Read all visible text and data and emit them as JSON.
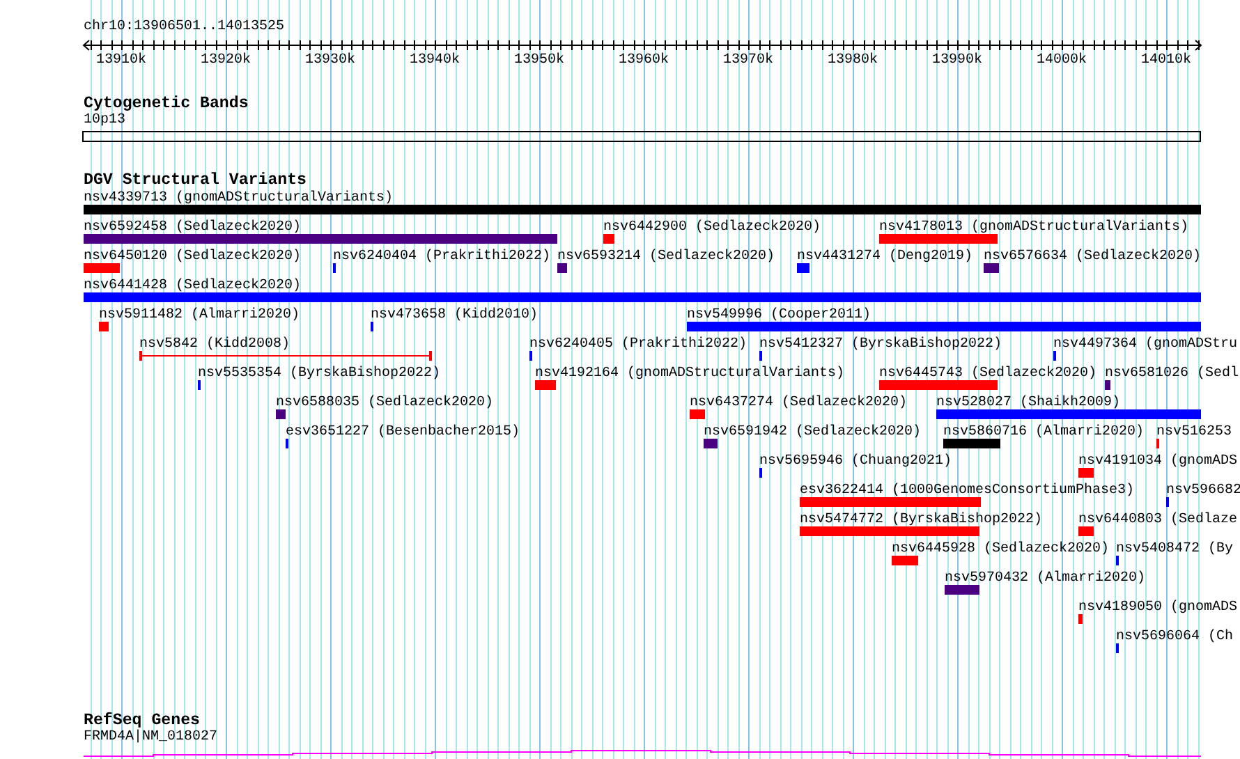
{
  "ruler": {
    "region": "chr10:13906501..14013525",
    "ticks": [
      "13910k",
      "13920k",
      "13930k",
      "13940k",
      "13950k",
      "13960k",
      "13970k",
      "13980k",
      "13990k",
      "14000k",
      "14010k"
    ]
  },
  "tracks": [
    {
      "kind": "bands",
      "title": "Cytogenetic Bands",
      "features": [
        {
          "label": "10p13"
        }
      ]
    },
    {
      "kind": "variants",
      "title": "DGV Structural Variants",
      "features": [
        {
          "label": "nsv4339713 (gnomADStructuralVariants)",
          "color": "#000000",
          "kind": "bar"
        },
        {
          "label": "nsv6592458 (Sedlazeck2020)",
          "color": "#4b0082",
          "kind": "bar"
        },
        {
          "label": "nsv6442900 (Sedlazeck2020)",
          "color": "#ff0000",
          "kind": "bar"
        },
        {
          "label": "nsv4178013 (gnomADStructuralVariants)",
          "color": "#ff0000",
          "kind": "bar"
        },
        {
          "label": "nsv6450120 (Sedlazeck2020)",
          "color": "#ff0000",
          "kind": "bar"
        },
        {
          "label": "nsv6240404 (Prakrithi2022)",
          "color": "#0000ff",
          "kind": "bar"
        },
        {
          "label": "nsv6593214 (Sedlazeck2020)",
          "color": "#4b0082",
          "kind": "bar"
        },
        {
          "label": "nsv4431274 (Deng2019)",
          "color": "#0000ff",
          "kind": "bar"
        },
        {
          "label": "nsv6576634 (Sedlazeck2020)",
          "color": "#4b0082",
          "kind": "bar"
        },
        {
          "label": "nsv6441428 (Sedlazeck2020)",
          "color": "#0000ff",
          "kind": "bar"
        },
        {
          "label": "nsv5911482 (Almarri2020)",
          "color": "#ff0000",
          "kind": "bar"
        },
        {
          "label": "nsv473658 (Kidd2010)",
          "color": "#0000ff",
          "kind": "bar"
        },
        {
          "label": "nsv549996 (Cooper2011)",
          "color": "#0000ff",
          "kind": "bar"
        },
        {
          "label": "nsv5842 (Kidd2008)",
          "color": "#ff0000",
          "kind": "span"
        },
        {
          "label": "nsv6240405 (Prakrithi2022)",
          "color": "#0000ff",
          "kind": "bar"
        },
        {
          "label": "nsv5412327 (ByrskaBishop2022)",
          "color": "#0000ff",
          "kind": "bar"
        },
        {
          "label": "nsv4497364 (gnomADStru",
          "color": "#0000ff",
          "kind": "bar"
        },
        {
          "label": "nsv5535354 (ByrskaBishop2022)",
          "color": "#0000ff",
          "kind": "bar"
        },
        {
          "label": "nsv4192164 (gnomADStructuralVariants)",
          "color": "#ff0000",
          "kind": "bar"
        },
        {
          "label": "nsv6445743 (Sedlazeck2020)",
          "color": "#ff0000",
          "kind": "bar"
        },
        {
          "label": "nsv6581026 (Sedl",
          "color": "#4b0082",
          "kind": "bar"
        },
        {
          "label": "nsv6588035 (Sedlazeck2020)",
          "color": "#4b0082",
          "kind": "bar"
        },
        {
          "label": "nsv6437274 (Sedlazeck2020)",
          "color": "#ff0000",
          "kind": "bar"
        },
        {
          "label": "nsv528027 (Shaikh2009)",
          "color": "#0000ff",
          "kind": "bar"
        },
        {
          "label": "esv3651227 (Besenbacher2015)",
          "color": "#0000ff",
          "kind": "bar"
        },
        {
          "label": "nsv6591942 (Sedlazeck2020)",
          "color": "#4b0082",
          "kind": "bar"
        },
        {
          "label": "nsv5860716 (Almarri2020)",
          "color": "#000000",
          "kind": "bar"
        },
        {
          "label": "nsv516253",
          "color": "#ff0000",
          "kind": "bar"
        },
        {
          "label": "nsv5695946 (Chuang2021)",
          "color": "#0000ff",
          "kind": "bar"
        },
        {
          "label": "nsv4191034 (gnomADS",
          "color": "#ff0000",
          "kind": "bar"
        },
        {
          "label": "esv3622414 (1000GenomesConsortiumPhase3)",
          "color": "#ff0000",
          "kind": "bar"
        },
        {
          "label": "nsv596682",
          "color": "#0000ff",
          "kind": "bar"
        },
        {
          "label": "nsv5474772 (ByrskaBishop2022)",
          "color": "#ff0000",
          "kind": "bar"
        },
        {
          "label": "nsv6440803 (Sedlaze",
          "color": "#ff0000",
          "kind": "bar"
        },
        {
          "label": "nsv6445928 (Sedlazeck2020)",
          "color": "#ff0000",
          "kind": "bar"
        },
        {
          "label": "nsv5408472 (By",
          "color": "#0000ff",
          "kind": "bar"
        },
        {
          "label": "nsv5970432 (Almarri2020)",
          "color": "#4b0082",
          "kind": "bar"
        },
        {
          "label": "nsv4189050 (gnomADS",
          "color": "#ff0000",
          "kind": "bar"
        },
        {
          "label": "nsv5696064 (Ch",
          "color": "#0000ff",
          "kind": "bar"
        }
      ]
    },
    {
      "kind": "genes",
      "title": "RefSeq Genes",
      "features": [
        {
          "label": "FRMD4A|NM_018027"
        }
      ]
    }
  ]
}
